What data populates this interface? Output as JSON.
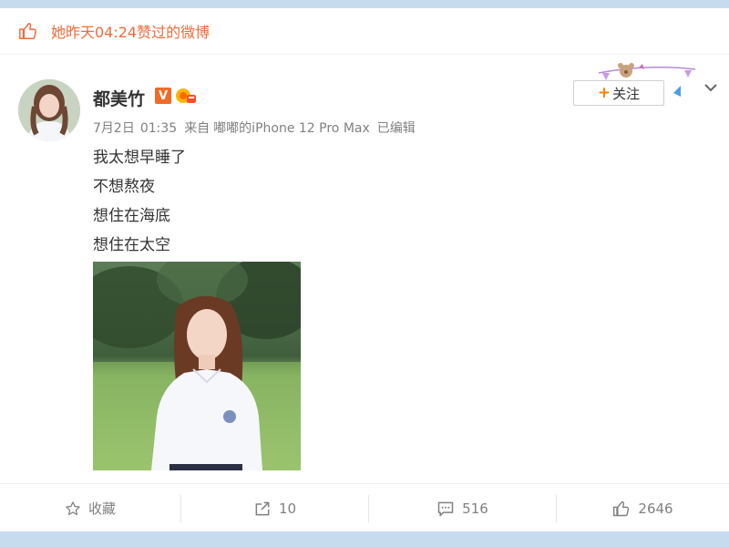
{
  "liked_notice": "她昨天04:24赞过的微博",
  "post": {
    "author": "都美竹",
    "vip_badge": "V",
    "date": "7月2日",
    "time": "01:35",
    "source_prefix": "来自",
    "source": "嘟嘟的iPhone 12 Pro Max",
    "edited": "已编辑",
    "follow_label": "关注",
    "lines": [
      "我太想早睡了",
      "不想熬夜",
      "想住在海底",
      "想住在太空"
    ]
  },
  "actions": {
    "favorite_label": "收藏",
    "repost_count": "10",
    "comment_count": "516",
    "like_count": "2646"
  },
  "colors": {
    "accent_orange": "#ff8200",
    "liked_text": "#f26b3a",
    "frame_blue": "#c7dbee"
  },
  "icons": [
    "thumbs-up-icon",
    "vip-v-icon",
    "level-badge-icon",
    "chevron-down-icon",
    "star-icon",
    "share-icon",
    "comment-icon",
    "like-icon"
  ]
}
